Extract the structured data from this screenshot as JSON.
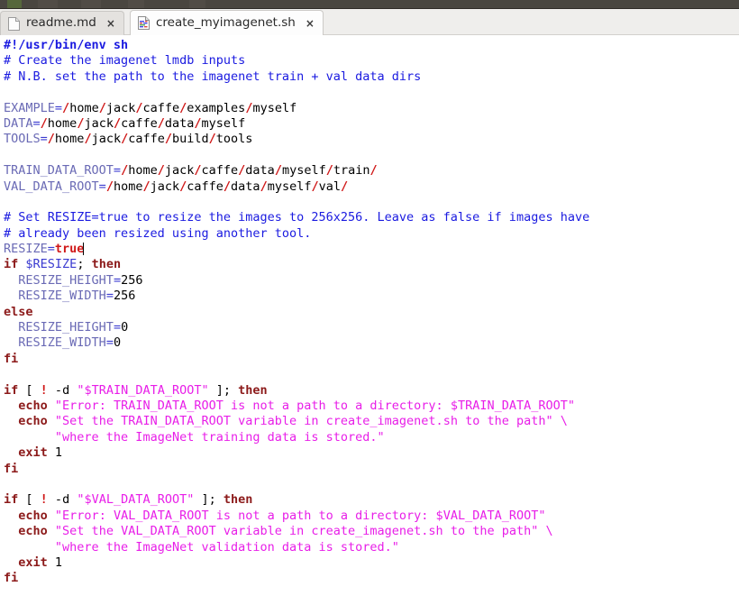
{
  "toolbar": {
    "visible": true,
    "background": "#4a4640"
  },
  "tabs": {
    "items": [
      {
        "label": "readme.md",
        "icon": "document-icon",
        "close_label": "×",
        "active": false
      },
      {
        "label": "create_myimagenet.sh",
        "icon": "script-document-icon",
        "close_label": "×",
        "active": true
      }
    ]
  },
  "editor": {
    "language": "shell",
    "caret_line": 13,
    "caret_after": "true",
    "colors": {
      "comment": "#1a1ae0",
      "shebang": "#1a1ae0",
      "variable": "#6a6ab5",
      "slash": "#d01818",
      "keyword": "#8c1a1a",
      "string": "#e81ee8",
      "plain": "#000000",
      "background": "#ffffff"
    },
    "lines": [
      "#!/usr/bin/env sh",
      "# Create the imagenet lmdb inputs",
      "# N.B. set the path to the imagenet train + val data dirs",
      "",
      "EXAMPLE=/home/jack/caffe/examples/myself",
      "DATA=/home/jack/caffe/data/myself",
      "TOOLS=/home/jack/caffe/build/tools",
      "",
      "TRAIN_DATA_ROOT=/home/jack/caffe/data/myself/train/",
      "VAL_DATA_ROOT=/home/jack/caffe/data/myself/val/",
      "",
      "# Set RESIZE=true to resize the images to 256x256. Leave as false if images have",
      "# already been resized using another tool.",
      "RESIZE=true",
      "if $RESIZE; then",
      "  RESIZE_HEIGHT=256",
      "  RESIZE_WIDTH=256",
      "else",
      "  RESIZE_HEIGHT=0",
      "  RESIZE_WIDTH=0",
      "fi",
      "",
      "if [ ! -d \"$TRAIN_DATA_ROOT\" ]; then",
      "  echo \"Error: TRAIN_DATA_ROOT is not a path to a directory: $TRAIN_DATA_ROOT\"",
      "  echo \"Set the TRAIN_DATA_ROOT variable in create_imagenet.sh to the path\" \\",
      "       \"where the ImageNet training data is stored.\"",
      "  exit 1",
      "fi",
      "",
      "if [ ! -d \"$VAL_DATA_ROOT\" ]; then",
      "  echo \"Error: VAL_DATA_ROOT is not a path to a directory: $VAL_DATA_ROOT\"",
      "  echo \"Set the VAL_DATA_ROOT variable in create_imagenet.sh to the path\" \\",
      "       \"where the ImageNet validation data is stored.\"",
      "  exit 1",
      "fi"
    ]
  }
}
